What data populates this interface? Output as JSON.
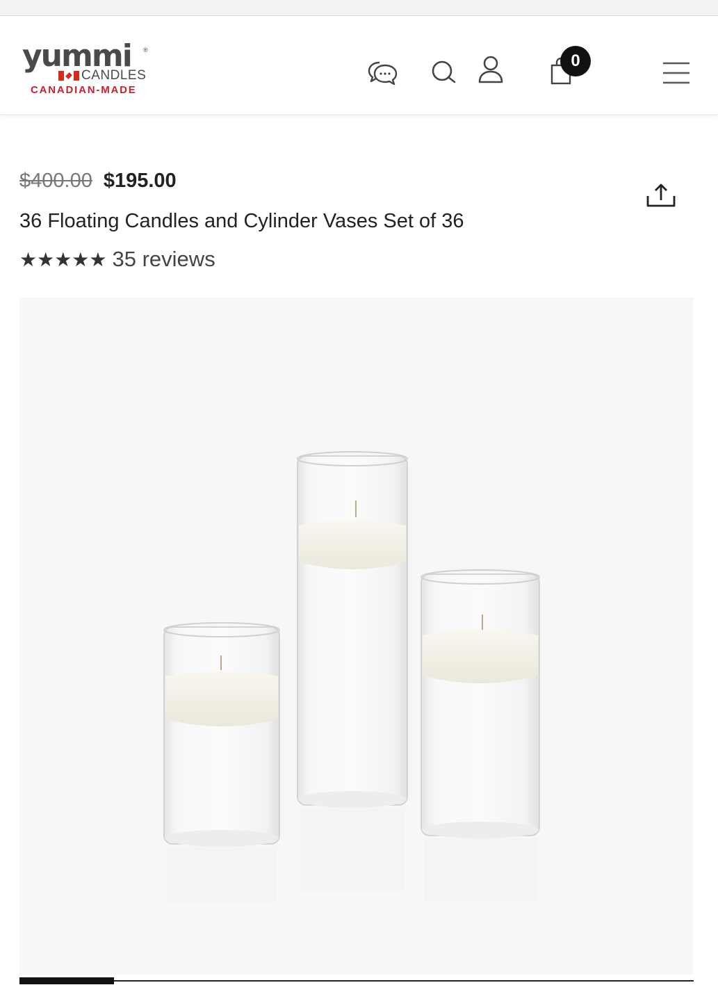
{
  "header": {
    "logo": {
      "wordmark": "yummi",
      "registered": "®",
      "candles": "CANDLES",
      "tagline": "CANADIAN-MADE"
    },
    "icons": {
      "chat": "chat-bubbles-icon",
      "search": "search-icon",
      "account": "user-icon",
      "cart": "shopping-bag-icon",
      "menu": "hamburger-menu-icon"
    },
    "cart_count": "0"
  },
  "product": {
    "price_original": "$400.00",
    "price_sale": "$195.00",
    "title": "36 Floating Candles and Cylinder Vases Set of 36",
    "stars": "★★★★★",
    "rating": 5,
    "reviews": "35 reviews"
  },
  "gallery": {
    "position": 1,
    "progress_fraction": 0.14
  },
  "colors": {
    "brand_red": "#c8202f",
    "text_dark": "#222222",
    "badge": "#111111"
  }
}
